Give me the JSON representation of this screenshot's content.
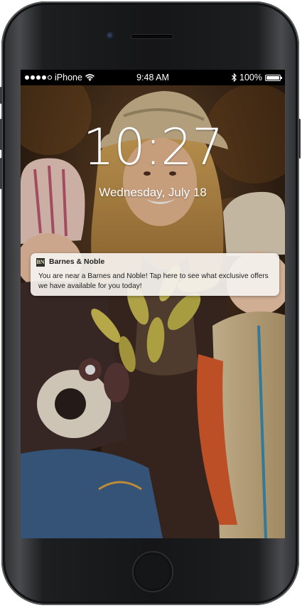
{
  "status_bar": {
    "carrier": "iPhone",
    "time": "9:48 AM",
    "battery": "100%",
    "battery_level": 1.0,
    "signal_bars": 4,
    "icons": [
      "signal-dots-icon",
      "wifi-icon",
      "bluetooth-icon",
      "battery-icon"
    ]
  },
  "lock_screen": {
    "time": "10:27",
    "date": "Wednesday, July 18"
  },
  "notification": {
    "app_icon_text": "BN",
    "app_name": "Barnes & Noble",
    "message": "You are near a Barnes and Noble! Tap here to see what exclusive offers we have available for you today!"
  },
  "colors": {
    "screen_bg": "#1b1410",
    "notification_bg": "#f5f2ee",
    "text_light": "#ffffff",
    "text_dark": "#222222"
  }
}
